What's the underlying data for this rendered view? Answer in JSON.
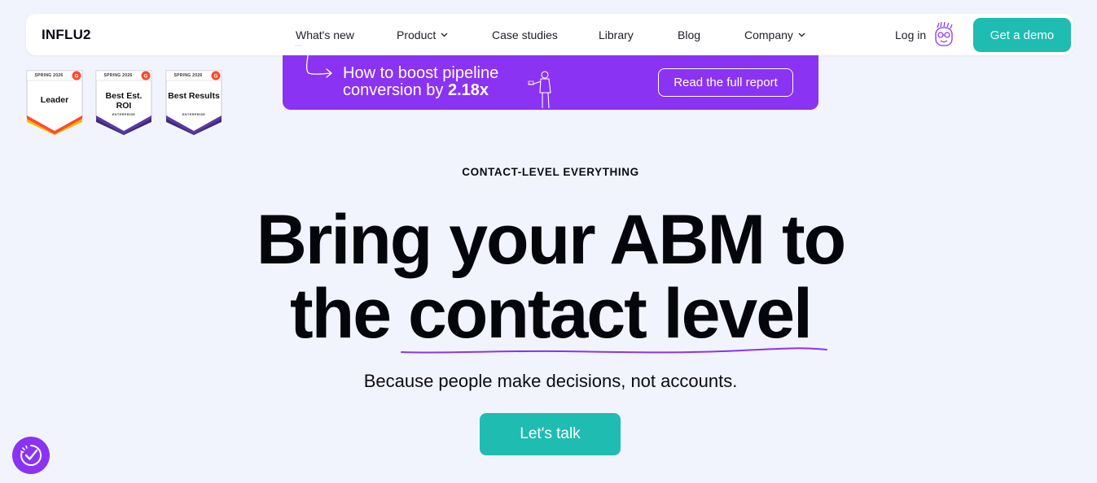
{
  "nav": {
    "logo": "INFLU2",
    "items": [
      {
        "label": "What's new"
      },
      {
        "label": "Product"
      },
      {
        "label": "Case studies"
      },
      {
        "label": "Library"
      },
      {
        "label": "Blog"
      },
      {
        "label": "Company"
      }
    ],
    "login": "Log in",
    "demo": "Get a demo"
  },
  "badges": [
    {
      "season": "SPRING 2026",
      "title": "Leader",
      "sub": ""
    },
    {
      "season": "SPRING 2026",
      "title": "Best Est. ROI",
      "sub": "ENTERPRISE"
    },
    {
      "season": "SPRING 2026",
      "title": "Best Results",
      "sub": "ENTERPRISE"
    }
  ],
  "promo": {
    "line1": "How to boost pipeline",
    "line2_prefix": "conversion by ",
    "line2_bold": "2.18x",
    "button": "Read the full report"
  },
  "hero": {
    "eyebrow": "CONTACT-LEVEL EVERYTHING",
    "title_line1": "Bring your ABM to",
    "title_line2_prefix": "the ",
    "title_line2_highlight": "contact level",
    "subtitle": "Because people make decisions, not accounts.",
    "cta": "Let's talk"
  },
  "colors": {
    "accent_teal": "#1fbcb1",
    "accent_purple": "#8a33f2",
    "background": "#f2f4fd"
  },
  "icons": [
    "chevron-down-icon",
    "avatar-doodle-icon",
    "g2-logo-icon",
    "arrow-doodle-icon",
    "person-doodle-icon",
    "clock-check-icon"
  ]
}
